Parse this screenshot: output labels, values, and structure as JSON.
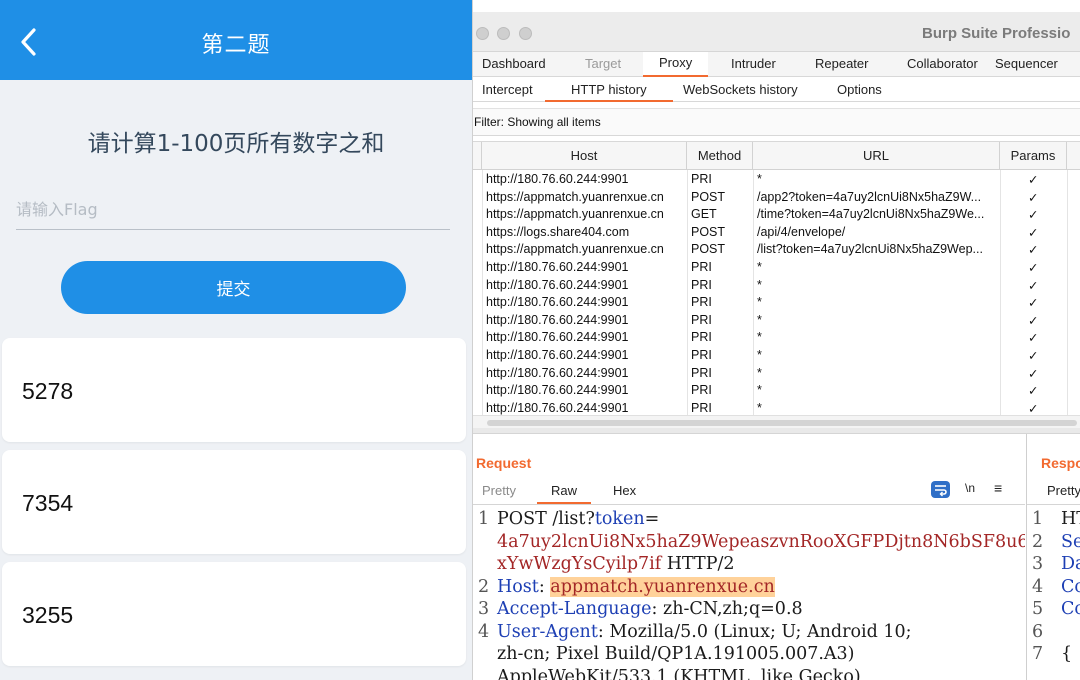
{
  "phone": {
    "title": "第二题",
    "question": "请计算1-100页所有数字之和",
    "flag_placeholder": "请输入Flag",
    "submit_label": "提交",
    "numbers": [
      "5278",
      "7354",
      "3255"
    ]
  },
  "burp": {
    "window_title": "Burp Suite Professio",
    "main_tabs": [
      "Dashboard",
      "Target",
      "Proxy",
      "Intruder",
      "Repeater",
      "Collaborator",
      "Sequencer"
    ],
    "proxy_tabs": [
      "Intercept",
      "HTTP history",
      "WebSockets history",
      "Options"
    ],
    "filter_text": "Filter: Showing all items",
    "columns": [
      "Host",
      "Method",
      "URL",
      "Params"
    ],
    "rows": [
      {
        "host": "http://180.76.60.244:9901",
        "method": "PRI",
        "url": "*",
        "params": "✓"
      },
      {
        "host": "https://appmatch.yuanrenxue.cn",
        "method": "POST",
        "url": "/app2?token=4a7uy2lcnUi8Nx5haZ9W...",
        "params": "✓"
      },
      {
        "host": "https://appmatch.yuanrenxue.cn",
        "method": "GET",
        "url": "/time?token=4a7uy2lcnUi8Nx5haZ9We...",
        "params": "✓"
      },
      {
        "host": "https://logs.share404.com",
        "method": "POST",
        "url": "/api/4/envelope/",
        "params": "✓"
      },
      {
        "host": "https://appmatch.yuanrenxue.cn",
        "method": "POST",
        "url": "/list?token=4a7uy2lcnUi8Nx5haZ9Wep...",
        "params": "✓"
      },
      {
        "host": "http://180.76.60.244:9901",
        "method": "PRI",
        "url": "*",
        "params": "✓"
      },
      {
        "host": "http://180.76.60.244:9901",
        "method": "PRI",
        "url": "*",
        "params": "✓"
      },
      {
        "host": "http://180.76.60.244:9901",
        "method": "PRI",
        "url": "*",
        "params": "✓"
      },
      {
        "host": "http://180.76.60.244:9901",
        "method": "PRI",
        "url": "*",
        "params": "✓"
      },
      {
        "host": "http://180.76.60.244:9901",
        "method": "PRI",
        "url": "*",
        "params": "✓"
      },
      {
        "host": "http://180.76.60.244:9901",
        "method": "PRI",
        "url": "*",
        "params": "✓"
      },
      {
        "host": "http://180.76.60.244:9901",
        "method": "PRI",
        "url": "*",
        "params": "✓"
      },
      {
        "host": "http://180.76.60.244:9901",
        "method": "PRI",
        "url": "*",
        "params": "✓"
      },
      {
        "host": "http://180.76.60.244:9901",
        "method": "PRI",
        "url": "*",
        "params": "✓"
      }
    ],
    "request": {
      "title": "Request",
      "tabs": [
        "Pretty",
        "Raw",
        "Hex"
      ],
      "nl_label": "\\n",
      "menu_glyph": "≡",
      "line_numbers": [
        "1",
        "2",
        "3",
        "4"
      ],
      "l1_method": "POST /list?",
      "l1_param": "token",
      "l1_eq": "=",
      "l1_value_a": "4a7uy2lcnUi8Nx5haZ9WepeaszvnRooXGFPDjtn8N6bSF8u6",
      "l1_value_b": "xYwWzgYsCyilp7if",
      "l1_proto": " HTTP/2",
      "l2_key": "Host",
      "l2_sep": ": ",
      "l2_val": "appmatch.yuanrenxue.cn",
      "l3_key": "Accept-Language",
      "l3_val": ": zh-CN,zh;q=0.8",
      "l4_key": "User-Agent",
      "l4_val": ": Mozilla/5.0 (Linux; U; Android 10;",
      "l4_cont1": "zh-cn; Pixel Build/QP1A.191005.007.A3)",
      "l4_cont2": "AppleWebKit/533.1 (KHTML, like Gecko)"
    },
    "response": {
      "title": "Respo",
      "tab": "Pretty",
      "line_numbers": [
        "1",
        "2",
        "3",
        "4",
        "5",
        "6",
        "7"
      ],
      "lines": [
        "HT",
        "Se",
        "Da",
        "Co",
        "Co",
        "",
        "{"
      ]
    }
  }
}
